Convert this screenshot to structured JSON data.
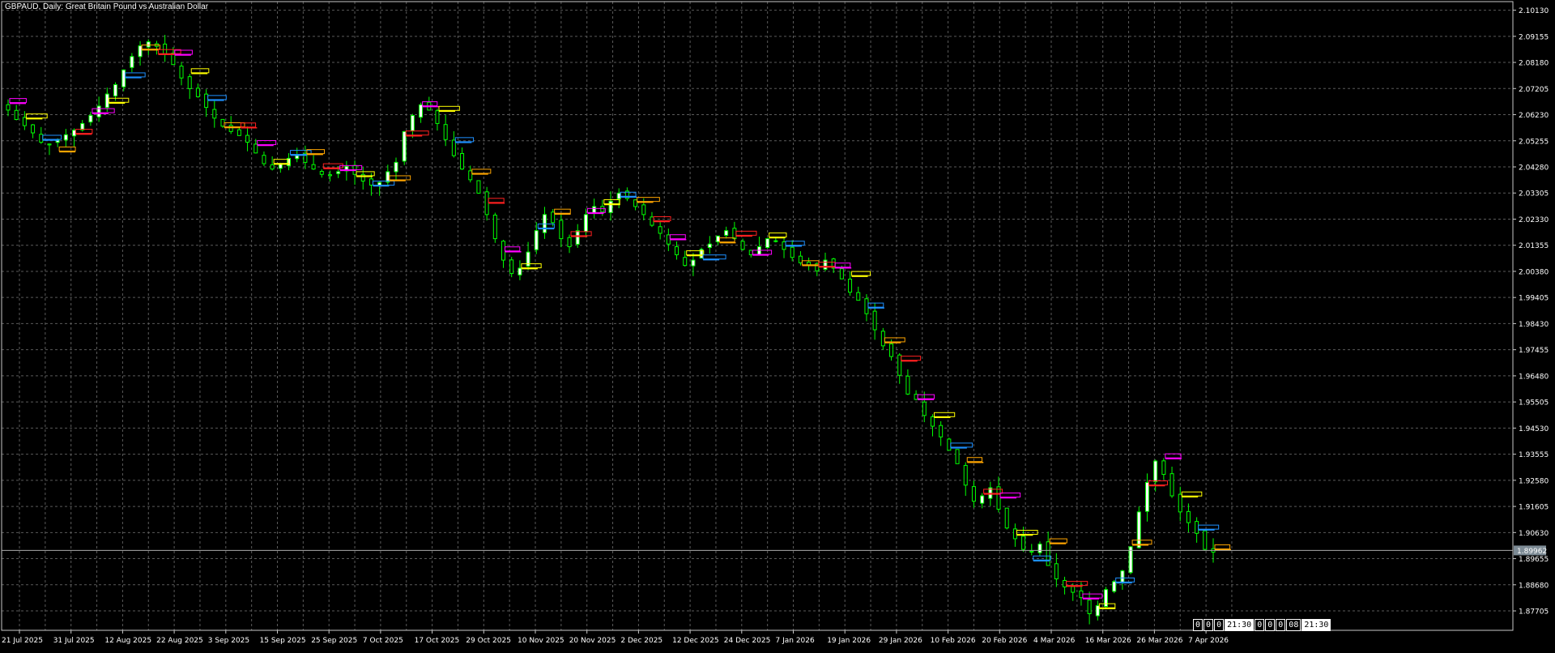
{
  "window": {
    "title": "GBPAUD, Daily:  Great Britain Pound vs Australian Dollar"
  },
  "colors": {
    "background": "#000000",
    "grid": "#5a5a5a",
    "bull_candle": "#ffffff",
    "bear_candle": "#000000",
    "wick": "#00ff00",
    "price_line": "#aaaaaa",
    "price_label_bg": "#7d8b95",
    "marker_magenta": "#ff00ff",
    "marker_orange": "#ffa500",
    "marker_yellow": "#ffff00",
    "marker_red": "#ff2020",
    "marker_blue": "#1e90ff"
  },
  "status_boxes": [
    "0",
    "0",
    "0",
    "21:30",
    "0",
    "0",
    "0",
    "08",
    "21:30"
  ],
  "chart_data": {
    "type": "candlestick",
    "symbol": "GBPAUD",
    "timeframe": "Daily",
    "title": "GBPAUD, Daily:  Great Britain Pound vs Australian Dollar",
    "ylim": [
      1.8698,
      2.1045
    ],
    "y_ticks": [
      "2.10130",
      "2.09155",
      "2.08180",
      "2.07205",
      "2.06230",
      "2.05255",
      "2.04280",
      "2.03305",
      "2.02330",
      "2.01355",
      "2.00380",
      "1.99405",
      "1.98430",
      "1.97455",
      "1.96480",
      "1.95505",
      "1.94530",
      "1.93555",
      "1.92580",
      "1.91605",
      "1.90630",
      "1.89655",
      "1.88680",
      "1.87705"
    ],
    "x_ticks": [
      "21 Jul 2025",
      "31 Jul 2025",
      "12 Aug 2025",
      "22 Aug 2025",
      "3 Sep 2025",
      "15 Sep 2025",
      "25 Sep 2025",
      "7 Oct 2025",
      "17 Oct 2025",
      "29 Oct 2025",
      "10 Nov 2025",
      "20 Nov 2025",
      "2 Dec 2025",
      "12 Dec 2025",
      "24 Dec 2025",
      "7 Jan 2026",
      "19 Jan 2026",
      "29 Jan 2026",
      "10 Feb 2026",
      "20 Feb 2026",
      "4 Mar 2026",
      "16 Mar 2026",
      "26 Mar 2026",
      "7 Apr 2026"
    ],
    "current_price": "1.89962",
    "grid": true,
    "approx_closes": [
      2.064,
      2.0605,
      2.0582,
      2.0555,
      2.052,
      2.051,
      2.053,
      2.0548,
      2.0565,
      2.059,
      2.062,
      2.0655,
      2.07,
      2.0735,
      2.079,
      2.084,
      2.088,
      2.0895,
      2.0878,
      2.085,
      2.081,
      2.076,
      2.072,
      2.069,
      2.065,
      2.061,
      2.058,
      2.056,
      2.0545,
      2.052,
      2.048,
      2.044,
      2.042,
      2.044,
      2.046,
      2.047,
      2.0445,
      2.042,
      2.04,
      2.0395,
      2.041,
      2.043,
      2.04,
      2.0375,
      2.036,
      2.037,
      2.041,
      2.0445,
      2.056,
      2.062,
      2.066,
      2.064,
      2.059,
      2.053,
      2.047,
      2.042,
      2.038,
      2.033,
      2.025,
      2.016,
      2.008,
      2.003,
      2.005,
      2.011,
      2.019,
      2.025,
      2.022,
      2.016,
      2.013,
      2.019,
      2.025,
      2.028,
      2.026,
      2.03,
      2.033,
      2.031,
      2.028,
      2.025,
      2.021,
      2.018,
      2.014,
      2.01,
      2.006,
      2.008,
      2.012,
      2.014,
      2.017,
      2.019,
      2.016,
      2.012,
      2.01,
      2.013,
      2.016,
      2.015,
      2.012,
      2.009,
      2.007,
      2.006,
      2.004,
      2.008,
      2.005,
      2.001,
      1.996,
      1.993,
      1.988,
      1.982,
      1.976,
      1.972,
      1.965,
      1.958,
      1.956,
      1.95,
      1.946,
      1.942,
      1.937,
      1.932,
      1.924,
      1.918,
      1.92,
      1.923,
      1.915,
      1.908,
      1.904,
      1.9,
      1.899,
      1.902,
      1.894,
      1.889,
      1.886,
      1.884,
      1.882,
      1.876,
      1.879,
      1.885,
      1.888,
      1.892,
      1.901,
      1.914,
      1.925,
      1.933,
      1.928,
      1.92,
      1.914,
      1.91,
      1.906,
      1.9,
      1.899
    ]
  }
}
